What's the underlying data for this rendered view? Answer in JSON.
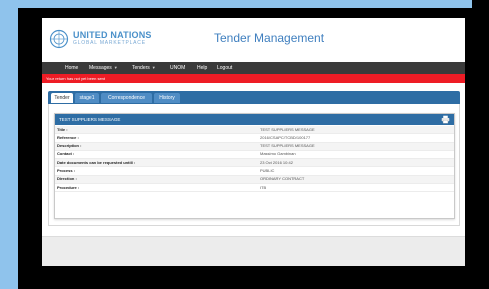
{
  "header": {
    "org_line1": "UNITED NATIONS",
    "org_line2": "GLOBAL MARKETPLACE",
    "page_title": "Tender Management"
  },
  "nav": {
    "items": [
      {
        "label": "Home",
        "has_menu": false
      },
      {
        "label": "Messages",
        "has_menu": true
      },
      {
        "label": "Tenders",
        "has_menu": true
      },
      {
        "label": "UNOM",
        "has_menu": false
      },
      {
        "label": "Help",
        "has_menu": false
      },
      {
        "label": "Logout",
        "has_menu": false
      }
    ]
  },
  "alert": {
    "text": "Your return has not yet been sent",
    "color": "#ee1c25"
  },
  "tabs": [
    {
      "label": "Tender",
      "active": true
    },
    {
      "label": "stage1",
      "active": false
    },
    {
      "label": "Correspondence",
      "active": false
    },
    {
      "label": "History",
      "active": false
    }
  ],
  "section": {
    "title": "TEST SUPPLIERS MESSAGE",
    "print_icon": "printer-icon",
    "rows": [
      {
        "label": "Title :",
        "value": "TEST SUPPLIERS MESSAGE"
      },
      {
        "label": "Reference :",
        "value": "2016/CSAPC/TCBD/100177"
      },
      {
        "label": "Description :",
        "value": "TEST SUPPLIERS MESSAGE"
      },
      {
        "label": "Contact :",
        "value": "Massimo Gambinan"
      },
      {
        "label": "Date documents can be requested untill :",
        "value": "23 Oct 2016 10:42"
      },
      {
        "label": "Process :",
        "value": "PUBLIC"
      },
      {
        "label": "Direction :",
        "value": "ORDINARY CONTRACT"
      },
      {
        "label": "Procedure :",
        "value": "ITB"
      }
    ]
  },
  "colors": {
    "accent": "#2e6da4",
    "brand": "#4a90c9",
    "nav_bg": "#3a3a3a"
  }
}
